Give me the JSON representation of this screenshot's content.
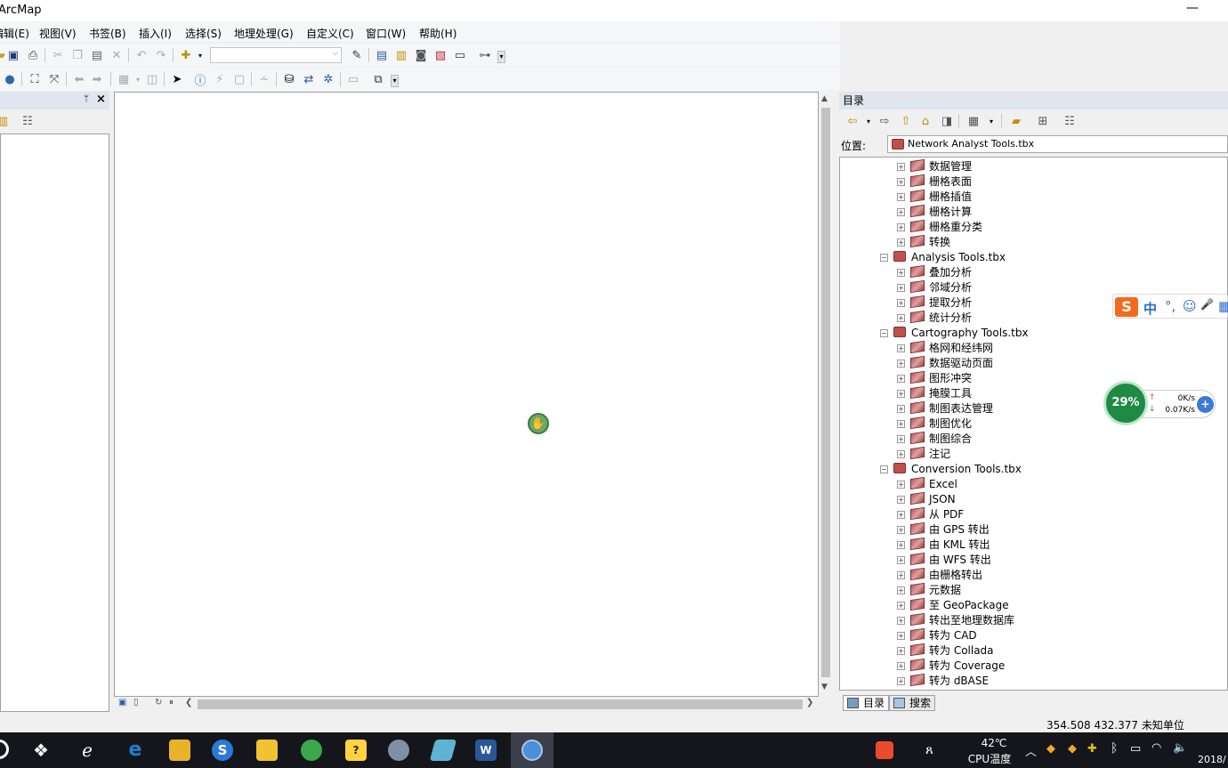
{
  "window": {
    "title": "ArcMap",
    "minimize": "—"
  },
  "menu": [
    "编辑(E)",
    "视图(V)",
    "书签(B)",
    "插入(I)",
    "选择(S)",
    "地理处理(G)",
    "自定义(C)",
    "窗口(W)",
    "帮助(H)"
  ],
  "leftpanel": {
    "pin": "ᛘ",
    "close": "×"
  },
  "catalog": {
    "title": "目录",
    "location_label": "位置:",
    "location_value": "Network Analyst Tools.tbx",
    "tree": [
      {
        "level": 2,
        "label": "数据管理"
      },
      {
        "level": 2,
        "label": "栅格表面"
      },
      {
        "level": 2,
        "label": "栅格插值"
      },
      {
        "level": 2,
        "label": "栅格计算"
      },
      {
        "level": 2,
        "label": "栅格重分类"
      },
      {
        "level": 2,
        "label": "转换"
      },
      {
        "level": 1,
        "label": "Analysis Tools.tbx"
      },
      {
        "level": 2,
        "label": "叠加分析"
      },
      {
        "level": 2,
        "label": "邻域分析"
      },
      {
        "level": 2,
        "label": "提取分析"
      },
      {
        "level": 2,
        "label": "统计分析"
      },
      {
        "level": 1,
        "label": "Cartography Tools.tbx"
      },
      {
        "level": 2,
        "label": "格网和经纬网"
      },
      {
        "level": 2,
        "label": "数据驱动页面"
      },
      {
        "level": 2,
        "label": "图形冲突"
      },
      {
        "level": 2,
        "label": "掩膜工具"
      },
      {
        "level": 2,
        "label": "制图表达管理"
      },
      {
        "level": 2,
        "label": "制图优化"
      },
      {
        "level": 2,
        "label": "制图综合"
      },
      {
        "level": 2,
        "label": "注记"
      },
      {
        "level": 1,
        "label": "Conversion Tools.tbx"
      },
      {
        "level": 2,
        "label": "Excel"
      },
      {
        "level": 2,
        "label": "JSON"
      },
      {
        "level": 2,
        "label": "从 PDF"
      },
      {
        "level": 2,
        "label": "由 GPS 转出"
      },
      {
        "level": 2,
        "label": "由 KML 转出"
      },
      {
        "level": 2,
        "label": "由 WFS 转出"
      },
      {
        "level": 2,
        "label": "由栅格转出"
      },
      {
        "level": 2,
        "label": "元数据"
      },
      {
        "level": 2,
        "label": "至 GeoPackage"
      },
      {
        "level": 2,
        "label": "转出至地理数据库"
      },
      {
        "level": 2,
        "label": "转为 CAD"
      },
      {
        "level": 2,
        "label": "转为 Collada"
      },
      {
        "level": 2,
        "label": "转为 Coverage"
      },
      {
        "level": 2,
        "label": "转为 dBASE"
      }
    ],
    "tabs": [
      "目录",
      "搜索"
    ]
  },
  "status": {
    "coords": "354.508  432.377 未知单位"
  },
  "ime": {
    "logo": "S",
    "mode": "中",
    "punct": "°,",
    "emoji": "☺",
    "mic": "🎤",
    "grid": "▦"
  },
  "network": {
    "percent": "29%",
    "upload": "0K/s",
    "download": "0.07K/s",
    "up_arrow": "↑",
    "down_arrow": "↓",
    "plus": "+"
  },
  "taskbar": {
    "tray_temp": "42℃",
    "tray_temp_label": "CPU温度",
    "date": "2018/"
  }
}
